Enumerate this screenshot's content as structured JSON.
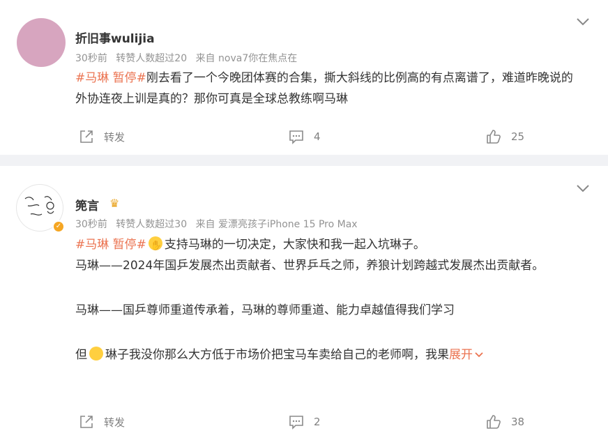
{
  "posts": [
    {
      "user": "折旧事wulijia",
      "meta": [
        "30秒前",
        "转赞人数超过20",
        "来自 nova7你在焦点在"
      ],
      "tag": "#马琳 暂停#",
      "text_lines": [
        "刚去看了一个今晚团体赛的合集，撕大斜线的比例高的有点离谱了，难道昨晚说的外协连夜上训是真的？那你可真是全球总教练啊马琳"
      ],
      "actions": {
        "forward": "转发",
        "comments": "4",
        "likes": "25"
      }
    },
    {
      "user": "篼言",
      "meta": [
        "30秒前",
        "转赞人数超过30",
        "来自 爱漂亮孩子iPhone 15 Pro Max"
      ],
      "tag": "#马琳 暂停#",
      "line1": "支持马琳的一切决定，大家快和我一起入坑琳子。",
      "line2": "马琳——2024年国乒发展杰出贡献者、世界乒乓之师，养狼计划跨越式发展杰出贡献者。",
      "line3": "马琳——国乒尊师重道传承着，马琳的尊师重道、能力卓越值得我们学习",
      "line4_prefix": "但",
      "line4": "琳子我没你那么大方低于市场价把宝马车卖给自己的老师啊，我果",
      "expand": "展开",
      "actions": {
        "forward": "转发",
        "comments": "2",
        "likes": "38"
      }
    }
  ],
  "colors": {
    "accent": "#eb7350",
    "meta": "#939393",
    "background": "#f1f2f5"
  },
  "icons": [
    "chevron-down-icon",
    "forward-icon",
    "comment-icon",
    "like-icon",
    "crown-icon",
    "verified-badge-icon"
  ]
}
